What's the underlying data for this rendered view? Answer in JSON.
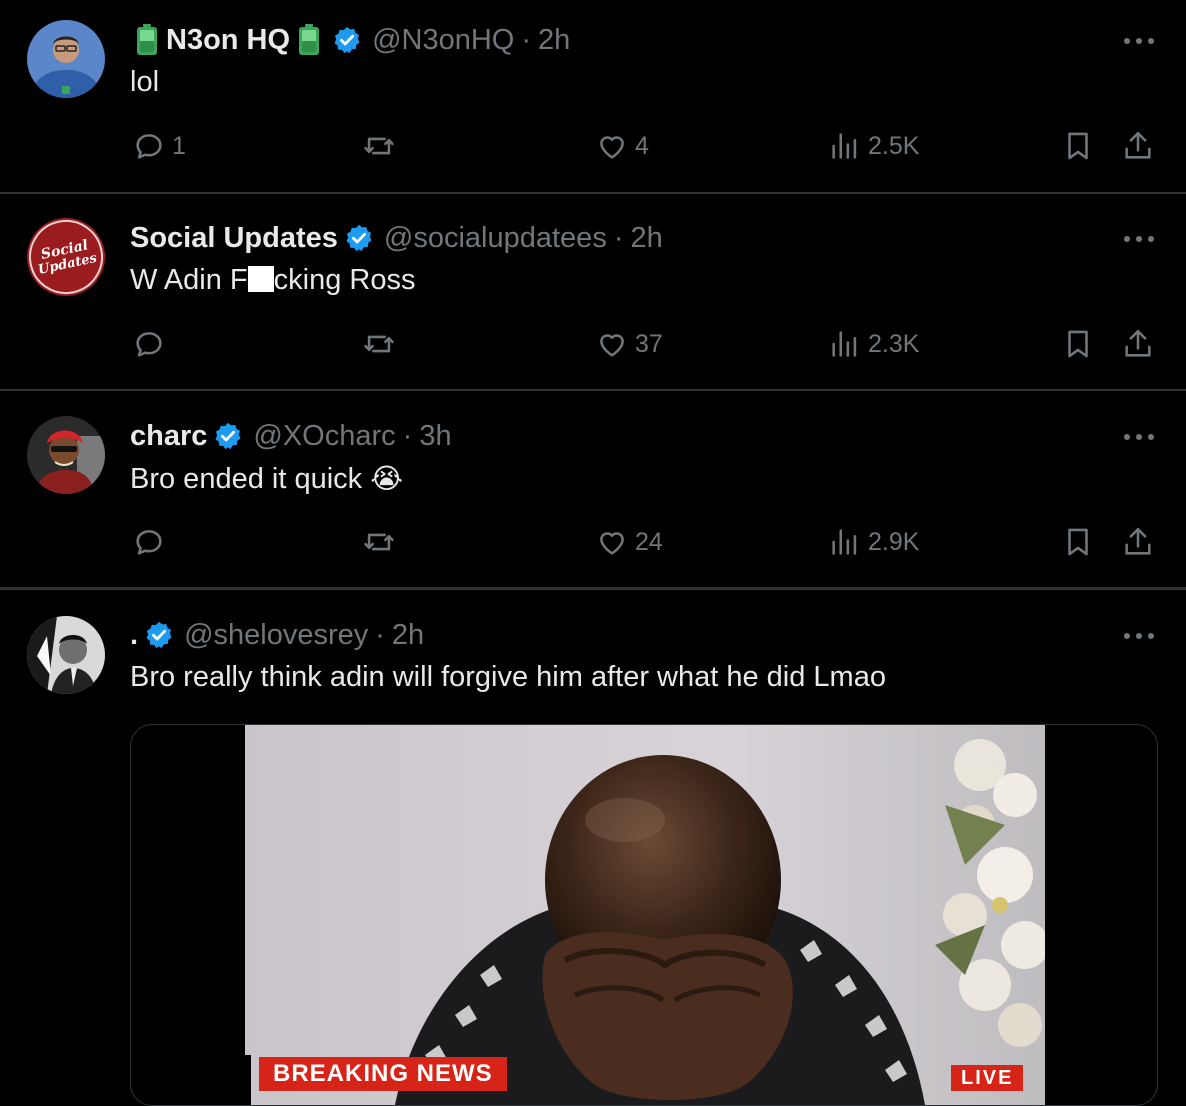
{
  "tweets": [
    {
      "name": "N3on HQ",
      "handle": "@N3onHQ",
      "time": "2h",
      "text": "lol",
      "replies": "1",
      "retweets": "",
      "likes": "4",
      "views": "2.5K"
    },
    {
      "name": "Social Updates",
      "handle": "@socialupdatees",
      "time": "2h",
      "text_start": "W Adin F",
      "text_end": "cking Ross",
      "replies": "",
      "retweets": "",
      "likes": "37",
      "views": "2.3K",
      "avatar_text_1": "Social",
      "avatar_text_2": "Updates"
    },
    {
      "name": "charc",
      "handle": "@XOcharc",
      "time": "3h",
      "text": "Bro ended it quick",
      "emoji": "😭",
      "replies": "",
      "retweets": "",
      "likes": "24",
      "views": "2.9K"
    },
    {
      "name": ".",
      "handle": "@shelovesrey",
      "time": "2h",
      "text": "Bro really think adin will forgive him after what he did Lmao",
      "media": {
        "banner": "BREAKING NEWS",
        "live": "LIVE"
      }
    }
  ],
  "separator": "·",
  "colors": {
    "background": "#000000",
    "text": "#e7e9ea",
    "muted": "#71767b",
    "divider": "#2f3336",
    "verified": "#1d9bf0",
    "battery": "#3ba55c",
    "news_red": "#d62418"
  },
  "icons": [
    "reply-icon",
    "retweet-icon",
    "like-icon",
    "views-icon",
    "bookmark-icon",
    "share-icon",
    "more-icon",
    "verified-badge-icon",
    "battery-icon"
  ]
}
